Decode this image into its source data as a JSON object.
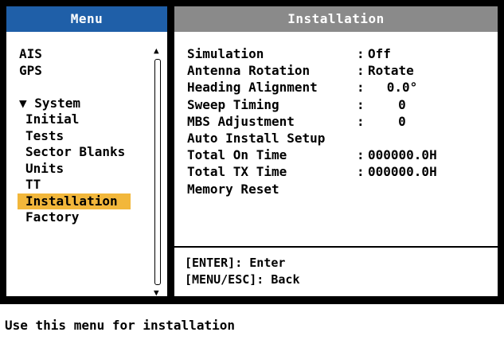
{
  "menu": {
    "title": "Menu",
    "items": [
      {
        "label": "AIS",
        "type": "top"
      },
      {
        "label": "GPS",
        "type": "top"
      },
      {
        "label": "",
        "type": "spacer"
      },
      {
        "label": "▼ System",
        "type": "top"
      },
      {
        "label": "Initial",
        "type": "sub"
      },
      {
        "label": "Tests",
        "type": "sub"
      },
      {
        "label": "Sector Blanks",
        "type": "sub"
      },
      {
        "label": "Units",
        "type": "sub"
      },
      {
        "label": "TT",
        "type": "sub"
      },
      {
        "label": "Installation",
        "type": "sub",
        "selected": true
      },
      {
        "label": "Factory",
        "type": "sub"
      }
    ],
    "scroll_up_icon": "▲",
    "scroll_down_icon": "▼"
  },
  "installation": {
    "title": "Installation",
    "rows": [
      {
        "label": "Simulation",
        "colon": ":",
        "value": "Off",
        "center": false
      },
      {
        "label": "Antenna Rotation",
        "colon": ":",
        "value": "Rotate",
        "center": false
      },
      {
        "label": "Heading Alignment",
        "colon": ":",
        "value": "0.0°",
        "center": true
      },
      {
        "label": "Sweep Timing",
        "colon": ":",
        "value": "0",
        "center": true
      },
      {
        "label": "MBS Adjustment",
        "colon": ":",
        "value": "0",
        "center": true
      },
      {
        "label": "Auto Install Setup",
        "colon": "",
        "value": "",
        "center": false
      },
      {
        "label": "Total On Time",
        "colon": ":",
        "value": "000000.0H",
        "center": false
      },
      {
        "label": "Total TX Time",
        "colon": ":",
        "value": "000000.0H",
        "center": false
      },
      {
        "label": "Memory Reset",
        "colon": "",
        "value": "",
        "center": false
      }
    ],
    "keys": {
      "enter": "[ENTER]: Enter",
      "back": "[MENU/ESC]: Back"
    }
  },
  "status": {
    "text": "Use this menu for installation"
  },
  "colors": {
    "menu_header": "#1f5fa8",
    "installation_header": "#8a8a8a",
    "selection": "#f2b73b",
    "background": "#000000"
  }
}
